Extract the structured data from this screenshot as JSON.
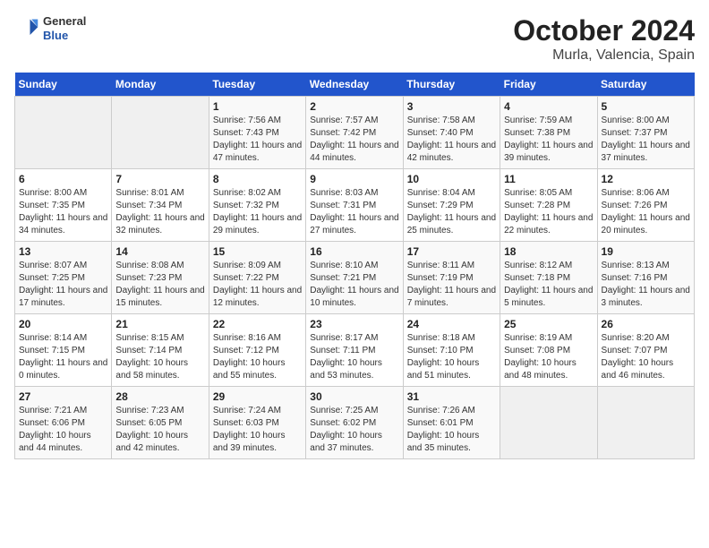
{
  "logo": {
    "general": "General",
    "blue": "Blue"
  },
  "title": "October 2024",
  "subtitle": "Murla, Valencia, Spain",
  "headers": [
    "Sunday",
    "Monday",
    "Tuesday",
    "Wednesday",
    "Thursday",
    "Friday",
    "Saturday"
  ],
  "weeks": [
    [
      {
        "day": "",
        "info": ""
      },
      {
        "day": "",
        "info": ""
      },
      {
        "day": "1",
        "info": "Sunrise: 7:56 AM\nSunset: 7:43 PM\nDaylight: 11 hours and 47 minutes."
      },
      {
        "day": "2",
        "info": "Sunrise: 7:57 AM\nSunset: 7:42 PM\nDaylight: 11 hours and 44 minutes."
      },
      {
        "day": "3",
        "info": "Sunrise: 7:58 AM\nSunset: 7:40 PM\nDaylight: 11 hours and 42 minutes."
      },
      {
        "day": "4",
        "info": "Sunrise: 7:59 AM\nSunset: 7:38 PM\nDaylight: 11 hours and 39 minutes."
      },
      {
        "day": "5",
        "info": "Sunrise: 8:00 AM\nSunset: 7:37 PM\nDaylight: 11 hours and 37 minutes."
      }
    ],
    [
      {
        "day": "6",
        "info": "Sunrise: 8:00 AM\nSunset: 7:35 PM\nDaylight: 11 hours and 34 minutes."
      },
      {
        "day": "7",
        "info": "Sunrise: 8:01 AM\nSunset: 7:34 PM\nDaylight: 11 hours and 32 minutes."
      },
      {
        "day": "8",
        "info": "Sunrise: 8:02 AM\nSunset: 7:32 PM\nDaylight: 11 hours and 29 minutes."
      },
      {
        "day": "9",
        "info": "Sunrise: 8:03 AM\nSunset: 7:31 PM\nDaylight: 11 hours and 27 minutes."
      },
      {
        "day": "10",
        "info": "Sunrise: 8:04 AM\nSunset: 7:29 PM\nDaylight: 11 hours and 25 minutes."
      },
      {
        "day": "11",
        "info": "Sunrise: 8:05 AM\nSunset: 7:28 PM\nDaylight: 11 hours and 22 minutes."
      },
      {
        "day": "12",
        "info": "Sunrise: 8:06 AM\nSunset: 7:26 PM\nDaylight: 11 hours and 20 minutes."
      }
    ],
    [
      {
        "day": "13",
        "info": "Sunrise: 8:07 AM\nSunset: 7:25 PM\nDaylight: 11 hours and 17 minutes."
      },
      {
        "day": "14",
        "info": "Sunrise: 8:08 AM\nSunset: 7:23 PM\nDaylight: 11 hours and 15 minutes."
      },
      {
        "day": "15",
        "info": "Sunrise: 8:09 AM\nSunset: 7:22 PM\nDaylight: 11 hours and 12 minutes."
      },
      {
        "day": "16",
        "info": "Sunrise: 8:10 AM\nSunset: 7:21 PM\nDaylight: 11 hours and 10 minutes."
      },
      {
        "day": "17",
        "info": "Sunrise: 8:11 AM\nSunset: 7:19 PM\nDaylight: 11 hours and 7 minutes."
      },
      {
        "day": "18",
        "info": "Sunrise: 8:12 AM\nSunset: 7:18 PM\nDaylight: 11 hours and 5 minutes."
      },
      {
        "day": "19",
        "info": "Sunrise: 8:13 AM\nSunset: 7:16 PM\nDaylight: 11 hours and 3 minutes."
      }
    ],
    [
      {
        "day": "20",
        "info": "Sunrise: 8:14 AM\nSunset: 7:15 PM\nDaylight: 11 hours and 0 minutes."
      },
      {
        "day": "21",
        "info": "Sunrise: 8:15 AM\nSunset: 7:14 PM\nDaylight: 10 hours and 58 minutes."
      },
      {
        "day": "22",
        "info": "Sunrise: 8:16 AM\nSunset: 7:12 PM\nDaylight: 10 hours and 55 minutes."
      },
      {
        "day": "23",
        "info": "Sunrise: 8:17 AM\nSunset: 7:11 PM\nDaylight: 10 hours and 53 minutes."
      },
      {
        "day": "24",
        "info": "Sunrise: 8:18 AM\nSunset: 7:10 PM\nDaylight: 10 hours and 51 minutes."
      },
      {
        "day": "25",
        "info": "Sunrise: 8:19 AM\nSunset: 7:08 PM\nDaylight: 10 hours and 48 minutes."
      },
      {
        "day": "26",
        "info": "Sunrise: 8:20 AM\nSunset: 7:07 PM\nDaylight: 10 hours and 46 minutes."
      }
    ],
    [
      {
        "day": "27",
        "info": "Sunrise: 7:21 AM\nSunset: 6:06 PM\nDaylight: 10 hours and 44 minutes."
      },
      {
        "day": "28",
        "info": "Sunrise: 7:23 AM\nSunset: 6:05 PM\nDaylight: 10 hours and 42 minutes."
      },
      {
        "day": "29",
        "info": "Sunrise: 7:24 AM\nSunset: 6:03 PM\nDaylight: 10 hours and 39 minutes."
      },
      {
        "day": "30",
        "info": "Sunrise: 7:25 AM\nSunset: 6:02 PM\nDaylight: 10 hours and 37 minutes."
      },
      {
        "day": "31",
        "info": "Sunrise: 7:26 AM\nSunset: 6:01 PM\nDaylight: 10 hours and 35 minutes."
      },
      {
        "day": "",
        "info": ""
      },
      {
        "day": "",
        "info": ""
      }
    ]
  ]
}
